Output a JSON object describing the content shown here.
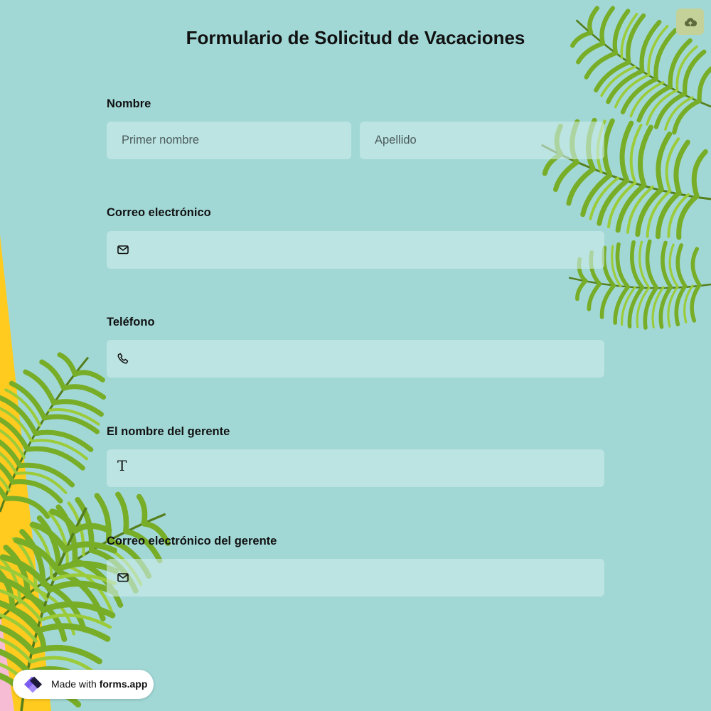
{
  "form": {
    "title": "Formulario de Solicitud de Vacaciones",
    "fields": {
      "name": {
        "label": "Nombre",
        "first_placeholder": "Primer nombre",
        "last_placeholder": "Apellido"
      },
      "email": {
        "label": "Correo electrónico",
        "icon": "envelope-icon"
      },
      "phone": {
        "label": "Teléfono",
        "icon": "phone-icon"
      },
      "manager_name": {
        "label": "El nombre del gerente",
        "icon": "text-icon",
        "icon_glyph": "T"
      },
      "manager_email": {
        "label": "Correo electrónico del gerente",
        "icon": "envelope-icon"
      }
    }
  },
  "toolbar": {
    "upload_icon": "cloud-upload-icon"
  },
  "branding": {
    "prefix": "Made with",
    "brand": "forms.app"
  },
  "theme": {
    "background": "#a1d8d6",
    "field_fill": "#cdecea",
    "upload_button": "#c4d29a",
    "accent_yellow": "#ffcb1f",
    "accent_pink": "#f5bcd4",
    "leaf_green": "#6a9c22",
    "logo_purple": "#7b5cf0"
  }
}
